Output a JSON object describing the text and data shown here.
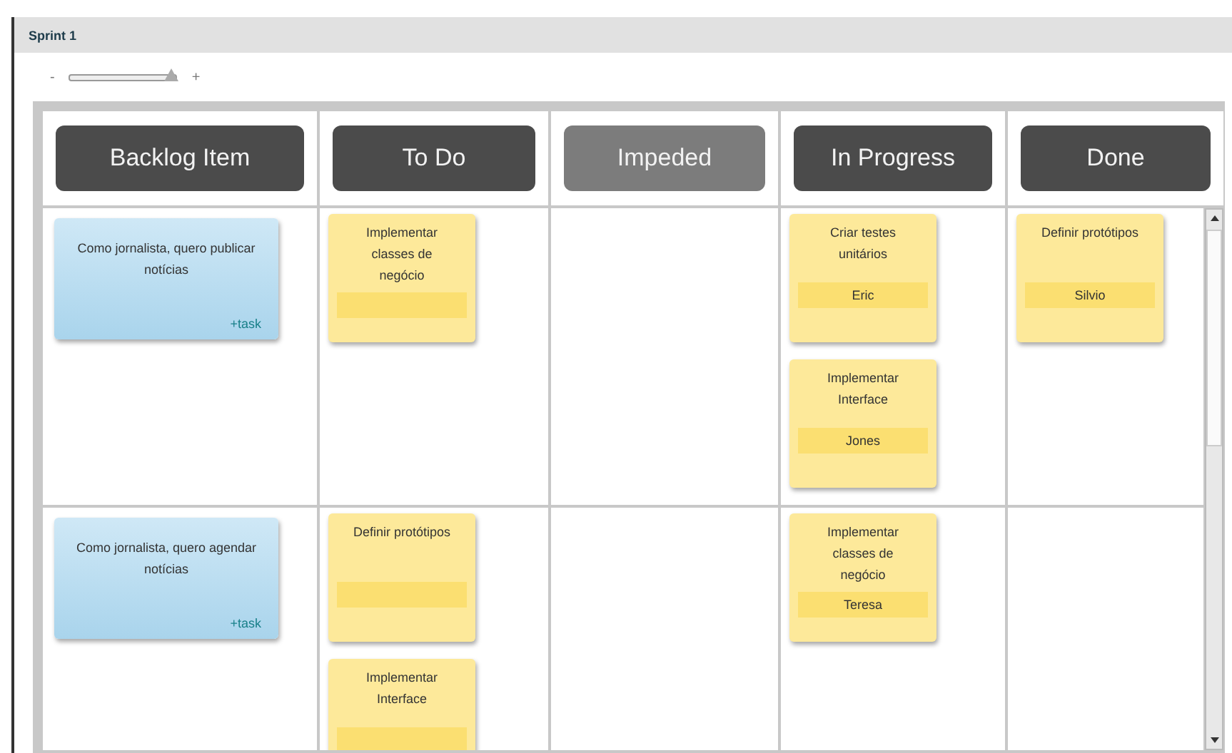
{
  "panel": {
    "title": "Sprint 1"
  },
  "zoom": {
    "minus": "-",
    "plus": "+",
    "level": 0.95
  },
  "board": {
    "columns": [
      {
        "title": "Backlog Item",
        "disabled": false
      },
      {
        "title": "To Do",
        "disabled": false
      },
      {
        "title": "Impeded",
        "disabled": true
      },
      {
        "title": "In Progress",
        "disabled": false
      },
      {
        "title": "Done",
        "disabled": false
      }
    ],
    "rows": [
      {
        "cells": [
          [
            {
              "kind": "story",
              "text": "Como jornalista, quero publicar notícias",
              "link": "+task"
            }
          ],
          [
            {
              "kind": "task",
              "title": "Implementar classes de negócio"
            }
          ],
          [],
          [
            {
              "kind": "task",
              "title": "Criar testes unitários",
              "assignee": "Eric"
            },
            {
              "kind": "task",
              "title": "Implementar Interface",
              "assignee": "Jones"
            }
          ],
          [
            {
              "kind": "task",
              "title": "Definir protótipos",
              "assignee": "Silvio"
            }
          ]
        ]
      },
      {
        "cells": [
          [
            {
              "kind": "story",
              "text": "Como jornalista, quero agendar notícias",
              "link": "+task"
            }
          ],
          [
            {
              "kind": "task",
              "title": "Definir protótipos"
            },
            {
              "kind": "task",
              "title": "Implementar Interface"
            }
          ],
          [],
          [
            {
              "kind": "task",
              "title": "Implementar classes de negócio",
              "assignee": "Teresa"
            }
          ],
          []
        ]
      }
    ]
  }
}
